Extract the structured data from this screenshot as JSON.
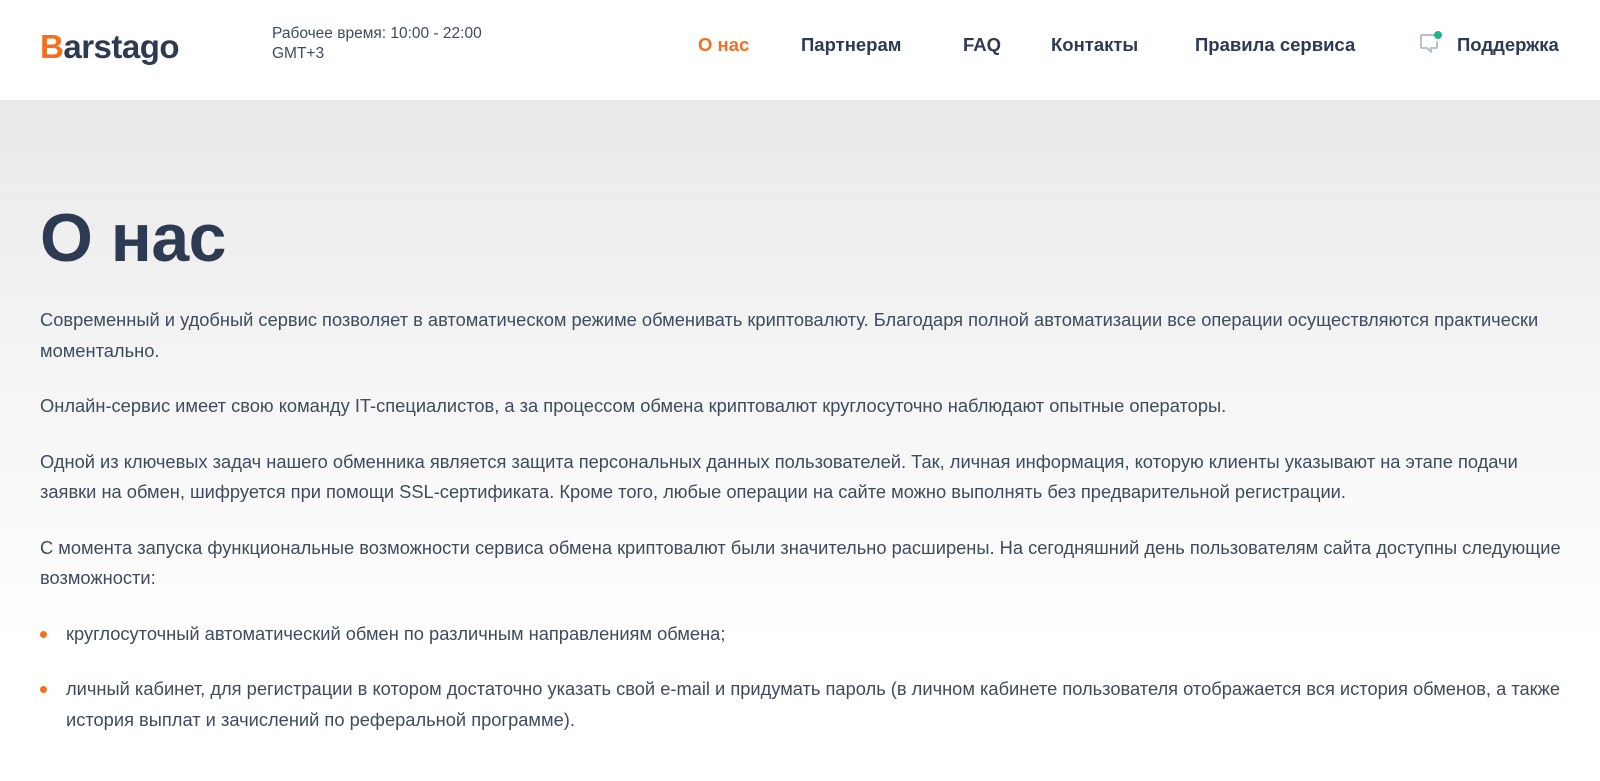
{
  "header": {
    "logo": {
      "first_letter": "B",
      "rest": "arstago"
    },
    "work_hours": "Рабочее время: 10:00 - 22:00 GMT+3",
    "nav": [
      {
        "label": "О нас",
        "active": true
      },
      {
        "label": "Партнерам",
        "active": false
      },
      {
        "label": "FAQ",
        "active": false
      },
      {
        "label": "Контакты",
        "active": false
      },
      {
        "label": "Правила сервиса",
        "active": false
      }
    ],
    "support": {
      "label": "Поддержка",
      "icon": "chat-bubble-icon",
      "status_dot_color": "#1fb58f"
    }
  },
  "main": {
    "title": "О нас",
    "paragraphs": [
      "Современный и удобный сервис позволяет в автоматическом режиме обменивать криптовалюту. Благодаря полной автоматизации все операции осуществляются практически моментально.",
      "Онлайн-сервис имеет свою команду IT-специалистов, а за процессом обмена криптовалют круглосуточно наблюдают опытные операторы.",
      "Одной из ключевых задач нашего обменника является защита персональных данных пользователей. Так, личная информация, которую клиенты указывают на этапе подачи заявки на обмен, шифруется при помощи SSL-сертификата. Кроме того, любые операции на сайте можно выполнять без предварительной регистрации.",
      "С момента запуска функциональные возможности сервиса обмена криптовалют были значительно расширены. На сегодняшний день пользователям сайта доступны следующие возможности:"
    ],
    "features": [
      "круглосуточный автоматический обмен по различным направлениям обмена;",
      "личный кабинет, для регистрации в котором достаточно указать свой e-mail и придумать пароль (в личном кабинете пользователя отображается вся история обменов, а также история выплат и зачислений по реферальной программе)."
    ]
  },
  "colors": {
    "accent": "#f37021",
    "text_dark": "#2d3b52",
    "text_body": "#3f4b5d"
  }
}
